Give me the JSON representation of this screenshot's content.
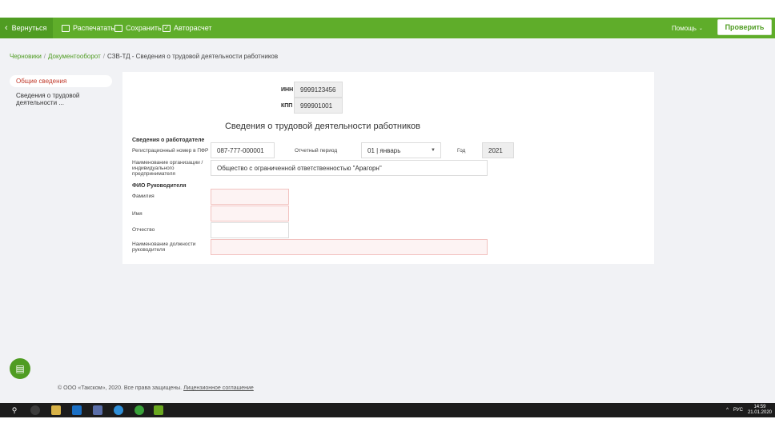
{
  "toolbar": {
    "back_label": "Вернуться",
    "print_label": "Распечатать",
    "save_label": "Сохранить",
    "autocalc_label": "Авторасчет",
    "help_label": "Помощь",
    "check_label": "Проверить"
  },
  "breadcrumb": {
    "drafts": "Черновики",
    "docflow": "Документооборот",
    "current": "СЗВ-ТД - Сведения о трудовой деятельности работников"
  },
  "sidebar": {
    "items": [
      {
        "label": "Общие сведения"
      },
      {
        "label": "Сведения о трудовой деятельности ..."
      }
    ]
  },
  "form": {
    "inn_label": "ИНН",
    "inn_value": "9999123456",
    "kpp_label": "КПП",
    "kpp_value": "999901001",
    "title": "Сведения о трудовой деятельности работников",
    "employer_section": "Сведения о работодателе",
    "pfr_label": "Регистрационный номер в ПФР",
    "pfr_value": "087-777-000001",
    "period_label": "Отчетный период",
    "period_value": "01 | январь",
    "year_label": "Год",
    "year_value": "2021",
    "org_label": "Наименование организации / индивидуального предпринимателя",
    "org_value": "Общество с ограниченной ответственностью \"Арагорн\"",
    "head_section": "ФИО Руководителя",
    "surname_label": "Фамилия",
    "name_label": "Имя",
    "patronymic_label": "Отчество",
    "position_label": "Наименование должности руководителя"
  },
  "footer": {
    "copyright": "© ООО «Такском», 2020. Все права защищены.",
    "license_link": "Лицензионное соглашение"
  },
  "taskbar": {
    "lang": "РУС",
    "time": "14:59",
    "date": "21.01.2020"
  },
  "colors": {
    "accent": "#5fad2a",
    "accent_dark": "#4f9c22",
    "error": "#c0392b"
  }
}
